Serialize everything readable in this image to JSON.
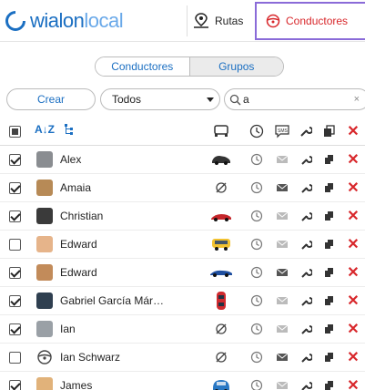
{
  "header": {
    "logo_main": "wialon",
    "logo_accent": "local",
    "tabs": [
      {
        "label": "Rutas"
      },
      {
        "label": "Conductores"
      }
    ]
  },
  "switcher": {
    "options": [
      "Conductores",
      "Grupos"
    ]
  },
  "toolbar": {
    "create_label": "Crear",
    "filter_value": "Todos",
    "search_value": "a",
    "clear_glyph": "×"
  },
  "table": {
    "header_sort_label": "A↓Z",
    "rows": [
      {
        "name": "Alex",
        "checked": true,
        "unit": "car-dark"
      },
      {
        "name": "Amaia",
        "checked": true,
        "unit": "none"
      },
      {
        "name": "Christian",
        "checked": true,
        "unit": "car-red"
      },
      {
        "name": "Edward",
        "checked": false,
        "unit": "truck-yellow"
      },
      {
        "name": "Edward",
        "checked": true,
        "unit": "car-blue"
      },
      {
        "name": "Gabriel García Már…",
        "checked": true,
        "unit": "car-red-vertical"
      },
      {
        "name": "Ian",
        "checked": true,
        "unit": "none"
      },
      {
        "name": "Ian Schwarz",
        "checked": false,
        "unit": "none"
      },
      {
        "name": "James",
        "checked": true,
        "unit": "car-blue-round"
      }
    ]
  },
  "colors": {
    "accent": "#1b6fc2",
    "danger": "#d8272b",
    "highlight_border": "#8a6bd8"
  }
}
